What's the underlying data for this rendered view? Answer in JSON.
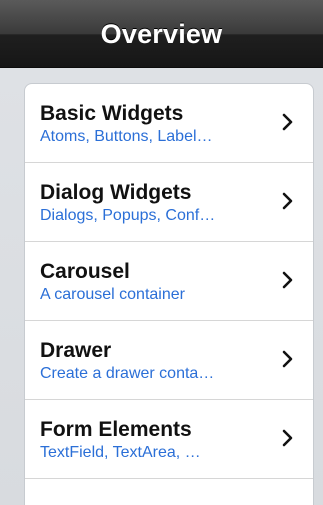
{
  "header": {
    "title": "Overview"
  },
  "list": {
    "items": [
      {
        "title": "Basic Widgets",
        "subtitle": "Atoms, Buttons, Label…",
        "icon": "chevron-right-icon"
      },
      {
        "title": "Dialog Widgets",
        "subtitle": "Dialogs, Popups, Conf…",
        "icon": "chevron-right-icon"
      },
      {
        "title": "Carousel",
        "subtitle": "A carousel container",
        "icon": "chevron-right-icon"
      },
      {
        "title": "Drawer",
        "subtitle": "Create a drawer conta…",
        "icon": "chevron-right-icon"
      },
      {
        "title": "Form Elements",
        "subtitle": "TextField, TextArea, …",
        "icon": "chevron-right-icon"
      }
    ]
  },
  "colors": {
    "title_bar": "#1f1f1f",
    "subtitle_text": "#2b6fd7",
    "background": "#dfe2e6"
  }
}
